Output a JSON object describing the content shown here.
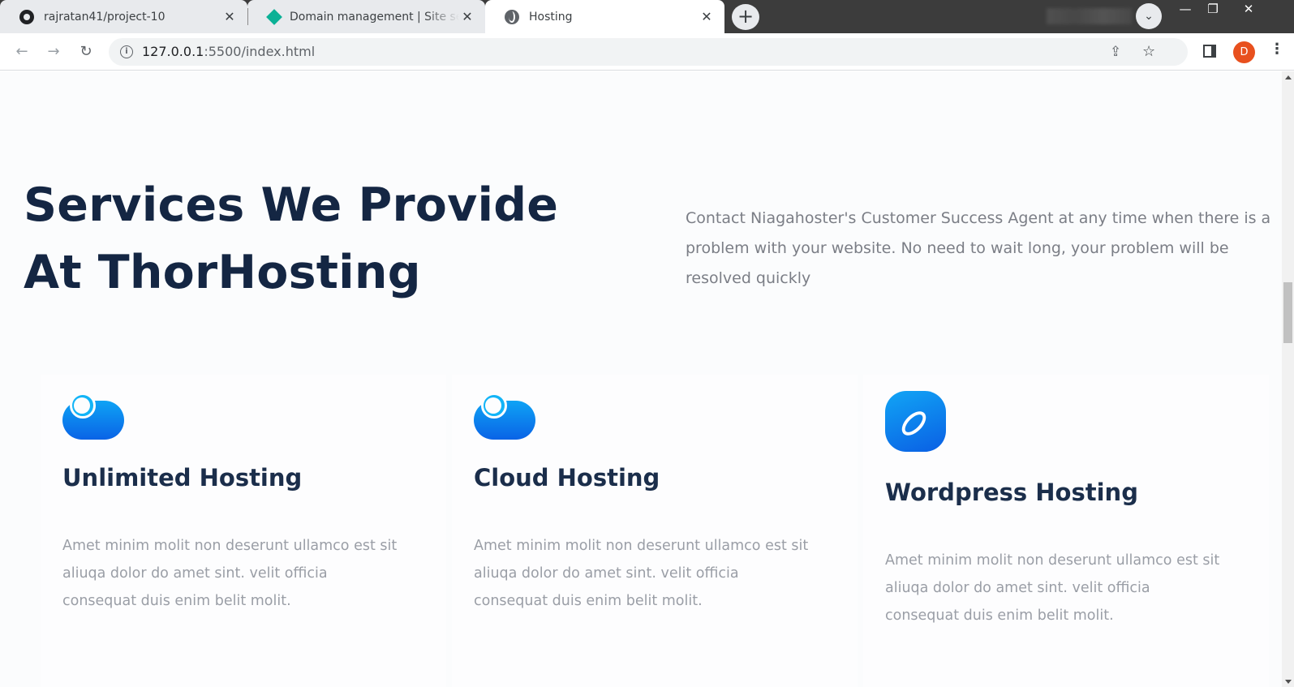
{
  "browser": {
    "tabs": [
      {
        "title": "rajratan41/project-10",
        "icon": "github-icon",
        "close": "✕"
      },
      {
        "title": "Domain management | Site settings",
        "icon": "netlify-diamond-icon",
        "close": "✕"
      },
      {
        "title": "Hosting",
        "icon": "globe-icon",
        "close": "✕",
        "active": true
      }
    ],
    "new_tab": "+",
    "tab_search": "⌄",
    "window_controls": {
      "minimize": "—",
      "maximize": "❐",
      "close": "✕"
    },
    "nav": {
      "back": "←",
      "forward": "→",
      "reload": "↻"
    },
    "url_host": "127.0.0.1",
    "url_rest": ":5500/index.html",
    "info_glyph": "i",
    "share_glyph": "⇪",
    "star_glyph": "☆",
    "avatar_initial": "D",
    "menu_glyph": "⋮",
    "profile_color": "#e8501e"
  },
  "page": {
    "headline": "Services We Provide At ThorHosting",
    "intro": "Contact Niagahoster's Customer Success Agent at any time when there is a problem with your website. No need to wait long, your problem will be resolved quickly",
    "services": [
      {
        "title": "Unlimited Hosting",
        "icon": "cloud-icon",
        "text": "Amet minim molit non deserunt ullamco est sit aliuqa dolor do amet sint. velit officia consequat duis enim belit molit."
      },
      {
        "title": "Cloud Hosting",
        "icon": "cloud-icon",
        "text": "Amet minim molit non deserunt ullamco est sit aliuqa dolor do amet sint. velit officia consequat duis enim belit molit."
      },
      {
        "title": "Wordpress Hosting",
        "icon": "wordpress-icon",
        "text": "Amet minim molit non deserunt ullamco est sit aliuqa dolor do amet sint. velit officia consequat duis enim belit molit."
      }
    ],
    "colors": {
      "heading": "#142643",
      "body_text": "#7b7e86",
      "icon_gradient_top": "#0ea3f5",
      "icon_gradient_bottom": "#0a63e6"
    }
  }
}
